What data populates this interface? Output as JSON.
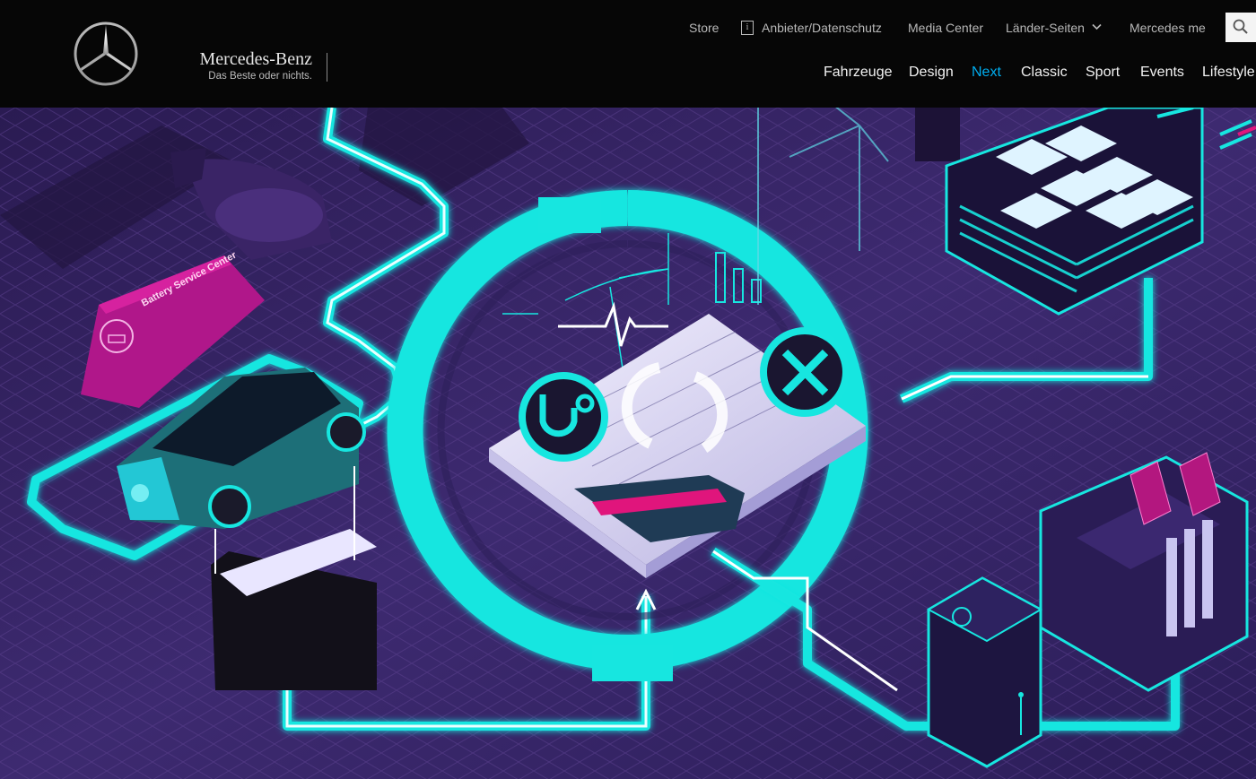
{
  "brand": {
    "name": "Mercedes-Benz",
    "tagline": "Das Beste oder nichts.",
    "logo_icon": "mercedes-star-icon"
  },
  "utility_nav": {
    "store": "Store",
    "imprint": "Anbieter/Datenschutz",
    "imprint_icon": "info-icon",
    "media_center": "Media Center",
    "countries": "Länder-Seiten",
    "countries_icon": "chevron-down-icon",
    "mercedes_me": "Mercedes me",
    "search_icon": "search-icon"
  },
  "main_nav": {
    "items": [
      "Fahrzeuge",
      "Design",
      "Next",
      "Classic",
      "Sport",
      "Events",
      "Lifestyle"
    ],
    "active": "Next"
  },
  "hero": {
    "battery_center_sign": "Battery Service Center",
    "illustration_icons": [
      "stethoscope-icon",
      "recycle-arrows-icon",
      "wrench-screwdriver-icon",
      "pulse-line-icon",
      "bar-chart-icon",
      "wind-turbine-icon",
      "solar-panel-icon",
      "home-battery-icon",
      "electric-car-icon"
    ]
  },
  "colors": {
    "header_bg": "#060606",
    "accent_link": "#00adef",
    "neon_cyan": "#17e6e0",
    "hero_purple": "#3a2668",
    "magenta": "#c8168f"
  }
}
